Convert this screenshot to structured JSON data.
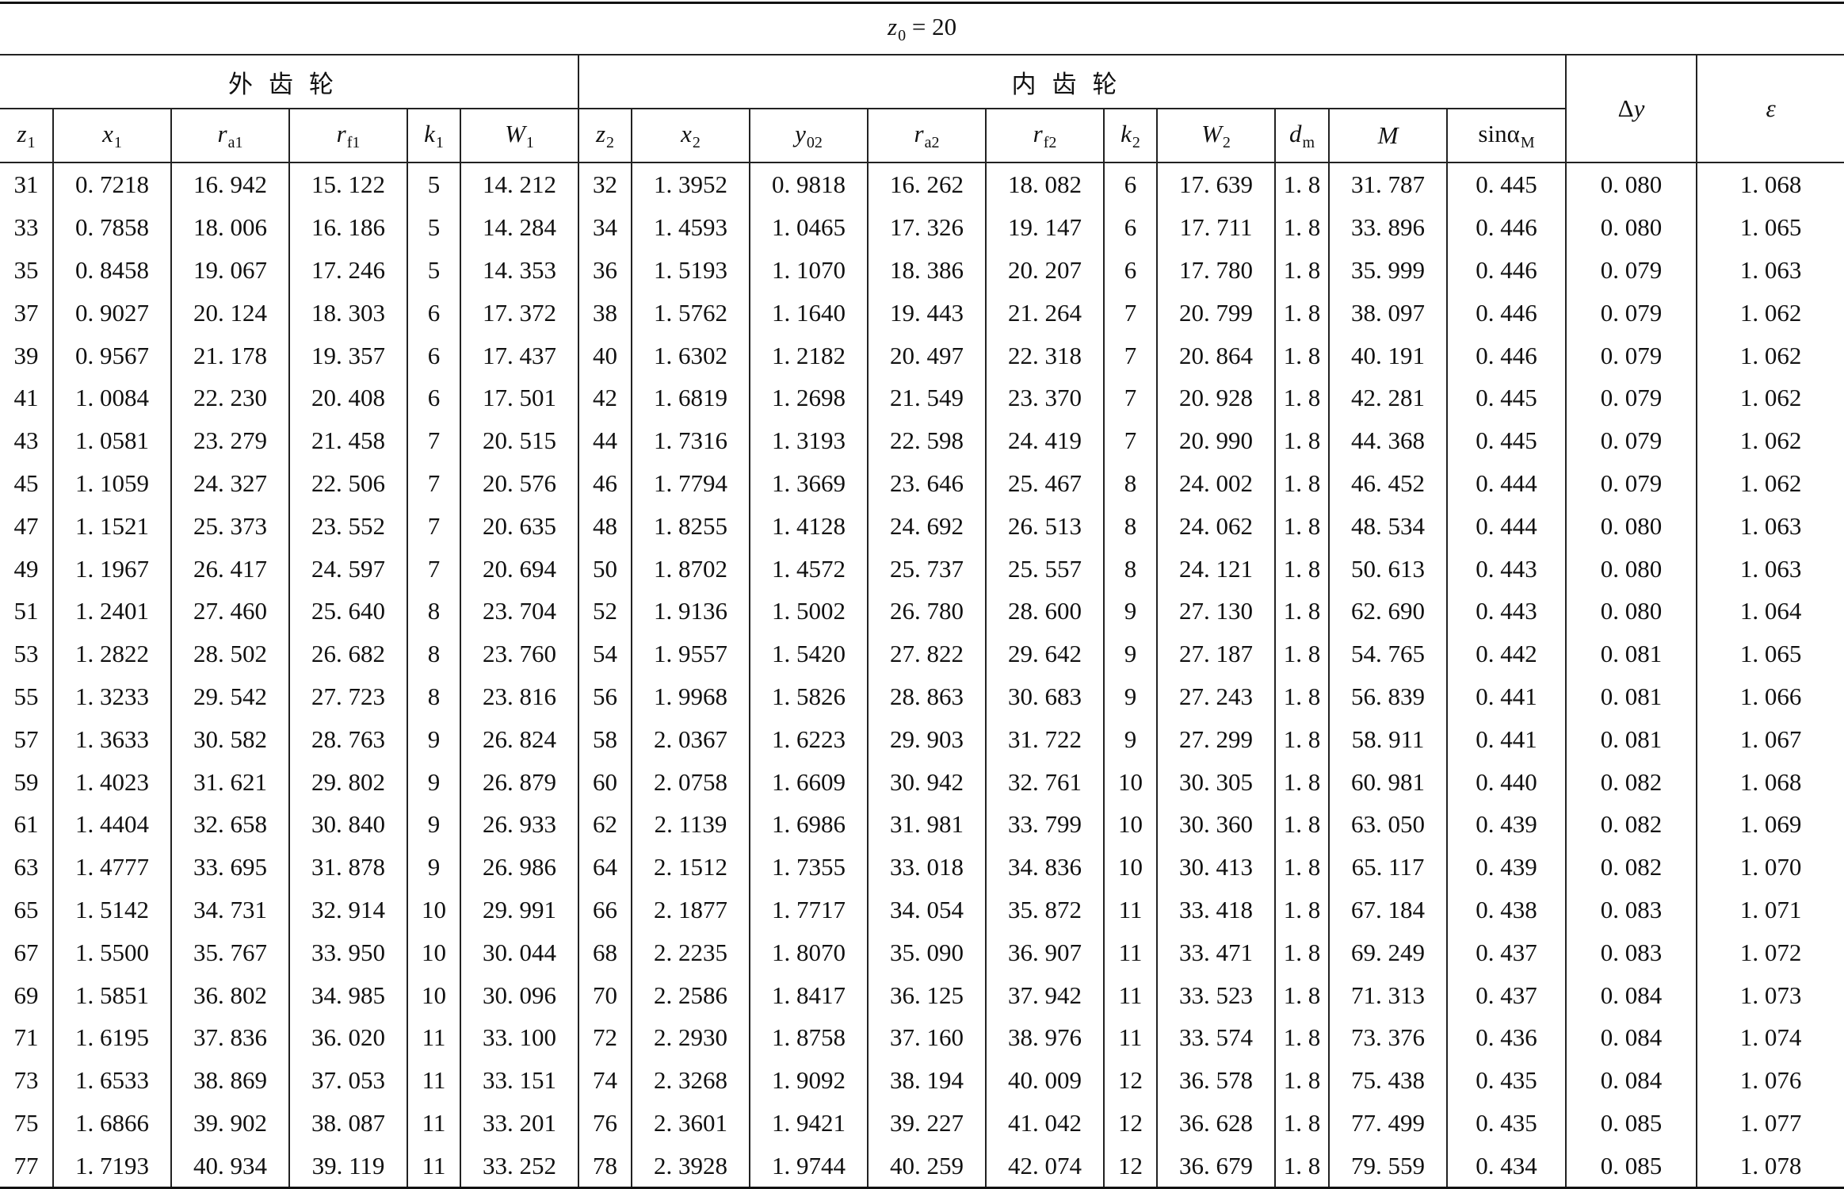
{
  "table": {
    "caption_var": "z",
    "caption_sub": "0",
    "caption_rest": " = 20",
    "group_external": "外齿轮",
    "group_internal": "内齿轮",
    "delta_y": {
      "pre": "Δ",
      "var": "y"
    },
    "epsilon": "ε",
    "columns": [
      {
        "var": "z",
        "sub": "1"
      },
      {
        "var": "x",
        "sub": "1"
      },
      {
        "var": "r",
        "sub": "a1"
      },
      {
        "var": "r",
        "sub": "f1"
      },
      {
        "var": "k",
        "sub": "1"
      },
      {
        "var": "W",
        "sub": "1"
      },
      {
        "var": "z",
        "sub": "2"
      },
      {
        "var": "x",
        "sub": "2"
      },
      {
        "var": "y",
        "sub": "02"
      },
      {
        "var": "r",
        "sub": "a2"
      },
      {
        "var": "r",
        "sub": "f2"
      },
      {
        "var": "k",
        "sub": "2"
      },
      {
        "var": "W",
        "sub": "2"
      },
      {
        "var": "d",
        "sub": "m"
      },
      {
        "var": "M",
        "sub": ""
      },
      {
        "var": "sinα",
        "sub": "M"
      }
    ],
    "rows": [
      [
        "31",
        "0. 7218",
        "16. 942",
        "15. 122",
        "5",
        "14. 212",
        "32",
        "1. 3952",
        "0. 9818",
        "16. 262",
        "18. 082",
        "6",
        "17. 639",
        "1. 8",
        "31. 787",
        "0. 445",
        "0. 080",
        "1. 068"
      ],
      [
        "33",
        "0. 7858",
        "18. 006",
        "16. 186",
        "5",
        "14. 284",
        "34",
        "1. 4593",
        "1. 0465",
        "17. 326",
        "19. 147",
        "6",
        "17. 711",
        "1. 8",
        "33. 896",
        "0. 446",
        "0. 080",
        "1. 065"
      ],
      [
        "35",
        "0. 8458",
        "19. 067",
        "17. 246",
        "5",
        "14. 353",
        "36",
        "1. 5193",
        "1. 1070",
        "18. 386",
        "20. 207",
        "6",
        "17. 780",
        "1. 8",
        "35. 999",
        "0. 446",
        "0. 079",
        "1. 063"
      ],
      [
        "37",
        "0. 9027",
        "20. 124",
        "18. 303",
        "6",
        "17. 372",
        "38",
        "1. 5762",
        "1. 1640",
        "19. 443",
        "21. 264",
        "7",
        "20. 799",
        "1. 8",
        "38. 097",
        "0. 446",
        "0. 079",
        "1. 062"
      ],
      [
        "39",
        "0. 9567",
        "21. 178",
        "19. 357",
        "6",
        "17. 437",
        "40",
        "1. 6302",
        "1. 2182",
        "20. 497",
        "22. 318",
        "7",
        "20. 864",
        "1. 8",
        "40. 191",
        "0. 446",
        "0. 079",
        "1. 062"
      ],
      [
        "41",
        "1. 0084",
        "22. 230",
        "20. 408",
        "6",
        "17. 501",
        "42",
        "1. 6819",
        "1. 2698",
        "21. 549",
        "23. 370",
        "7",
        "20. 928",
        "1. 8",
        "42. 281",
        "0. 445",
        "0. 079",
        "1. 062"
      ],
      [
        "43",
        "1. 0581",
        "23. 279",
        "21. 458",
        "7",
        "20. 515",
        "44",
        "1. 7316",
        "1. 3193",
        "22. 598",
        "24. 419",
        "7",
        "20. 990",
        "1. 8",
        "44. 368",
        "0. 445",
        "0. 079",
        "1. 062"
      ],
      [
        "45",
        "1. 1059",
        "24. 327",
        "22. 506",
        "7",
        "20. 576",
        "46",
        "1. 7794",
        "1. 3669",
        "23. 646",
        "25. 467",
        "8",
        "24. 002",
        "1. 8",
        "46. 452",
        "0. 444",
        "0. 079",
        "1. 062"
      ],
      [
        "47",
        "1. 1521",
        "25. 373",
        "23. 552",
        "7",
        "20. 635",
        "48",
        "1. 8255",
        "1. 4128",
        "24. 692",
        "26. 513",
        "8",
        "24. 062",
        "1. 8",
        "48. 534",
        "0. 444",
        "0. 080",
        "1. 063"
      ],
      [
        "49",
        "1. 1967",
        "26. 417",
        "24. 597",
        "7",
        "20. 694",
        "50",
        "1. 8702",
        "1. 4572",
        "25. 737",
        "25. 557",
        "8",
        "24. 121",
        "1. 8",
        "50. 613",
        "0. 443",
        "0. 080",
        "1. 063"
      ],
      [
        "51",
        "1. 2401",
        "27. 460",
        "25. 640",
        "8",
        "23. 704",
        "52",
        "1. 9136",
        "1. 5002",
        "26. 780",
        "28. 600",
        "9",
        "27. 130",
        "1. 8",
        "62. 690",
        "0. 443",
        "0. 080",
        "1. 064"
      ],
      [
        "53",
        "1. 2822",
        "28. 502",
        "26. 682",
        "8",
        "23. 760",
        "54",
        "1. 9557",
        "1. 5420",
        "27. 822",
        "29. 642",
        "9",
        "27. 187",
        "1. 8",
        "54. 765",
        "0. 442",
        "0. 081",
        "1. 065"
      ],
      [
        "55",
        "1. 3233",
        "29. 542",
        "27. 723",
        "8",
        "23. 816",
        "56",
        "1. 9968",
        "1. 5826",
        "28. 863",
        "30. 683",
        "9",
        "27. 243",
        "1. 8",
        "56. 839",
        "0. 441",
        "0. 081",
        "1. 066"
      ],
      [
        "57",
        "1. 3633",
        "30. 582",
        "28. 763",
        "9",
        "26. 824",
        "58",
        "2. 0367",
        "1. 6223",
        "29. 903",
        "31. 722",
        "9",
        "27. 299",
        "1. 8",
        "58. 911",
        "0. 441",
        "0. 081",
        "1. 067"
      ],
      [
        "59",
        "1. 4023",
        "31. 621",
        "29. 802",
        "9",
        "26. 879",
        "60",
        "2. 0758",
        "1. 6609",
        "30. 942",
        "32. 761",
        "10",
        "30. 305",
        "1. 8",
        "60. 981",
        "0. 440",
        "0. 082",
        "1. 068"
      ],
      [
        "61",
        "1. 4404",
        "32. 658",
        "30. 840",
        "9",
        "26. 933",
        "62",
        "2. 1139",
        "1. 6986",
        "31. 981",
        "33. 799",
        "10",
        "30. 360",
        "1. 8",
        "63. 050",
        "0. 439",
        "0. 082",
        "1. 069"
      ],
      [
        "63",
        "1. 4777",
        "33. 695",
        "31. 878",
        "9",
        "26. 986",
        "64",
        "2. 1512",
        "1. 7355",
        "33. 018",
        "34. 836",
        "10",
        "30. 413",
        "1. 8",
        "65. 117",
        "0. 439",
        "0. 082",
        "1. 070"
      ],
      [
        "65",
        "1. 5142",
        "34. 731",
        "32. 914",
        "10",
        "29. 991",
        "66",
        "2. 1877",
        "1. 7717",
        "34. 054",
        "35. 872",
        "11",
        "33. 418",
        "1. 8",
        "67. 184",
        "0. 438",
        "0. 083",
        "1. 071"
      ],
      [
        "67",
        "1. 5500",
        "35. 767",
        "33. 950",
        "10",
        "30. 044",
        "68",
        "2. 2235",
        "1. 8070",
        "35. 090",
        "36. 907",
        "11",
        "33. 471",
        "1. 8",
        "69. 249",
        "0. 437",
        "0. 083",
        "1. 072"
      ],
      [
        "69",
        "1. 5851",
        "36. 802",
        "34. 985",
        "10",
        "30. 096",
        "70",
        "2. 2586",
        "1. 8417",
        "36. 125",
        "37. 942",
        "11",
        "33. 523",
        "1. 8",
        "71. 313",
        "0. 437",
        "0. 084",
        "1. 073"
      ],
      [
        "71",
        "1. 6195",
        "37. 836",
        "36. 020",
        "11",
        "33. 100",
        "72",
        "2. 2930",
        "1. 8758",
        "37. 160",
        "38. 976",
        "11",
        "33. 574",
        "1. 8",
        "73. 376",
        "0. 436",
        "0. 084",
        "1. 074"
      ],
      [
        "73",
        "1. 6533",
        "38. 869",
        "37. 053",
        "11",
        "33. 151",
        "74",
        "2. 3268",
        "1. 9092",
        "38. 194",
        "40. 009",
        "12",
        "36. 578",
        "1. 8",
        "75. 438",
        "0. 435",
        "0. 084",
        "1. 076"
      ],
      [
        "75",
        "1. 6866",
        "39. 902",
        "38. 087",
        "11",
        "33. 201",
        "76",
        "2. 3601",
        "1. 9421",
        "39. 227",
        "41. 042",
        "12",
        "36. 628",
        "1. 8",
        "77. 499",
        "0. 435",
        "0. 085",
        "1. 077"
      ],
      [
        "77",
        "1. 7193",
        "40. 934",
        "39. 119",
        "11",
        "33. 252",
        "78",
        "2. 3928",
        "1. 9744",
        "40. 259",
        "42. 074",
        "12",
        "36. 679",
        "1. 8",
        "79. 559",
        "0. 434",
        "0. 085",
        "1. 078"
      ]
    ]
  }
}
